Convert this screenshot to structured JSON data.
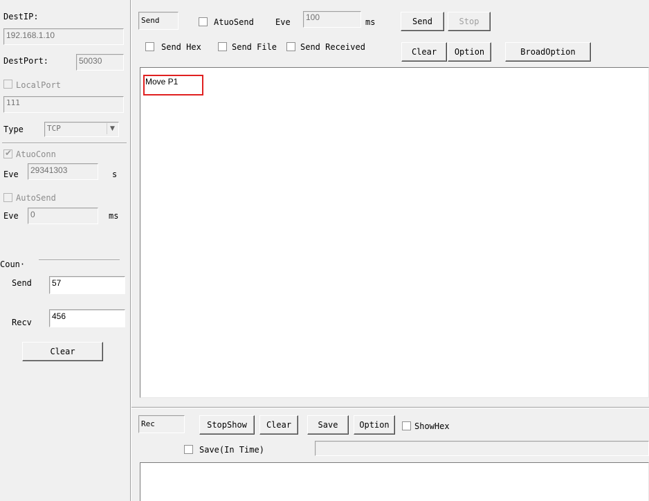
{
  "left_panel": {
    "dest_ip_label": "DestIP:",
    "dest_ip_value": "192.168.1.10",
    "dest_port_label": "DestPort:",
    "dest_port_value": "50030",
    "local_port_label": "LocalPort",
    "local_port_value": "111",
    "type_label": "Type",
    "type_value": "TCP",
    "auto_conn_label": "AtuoConn",
    "eve_label_1": "Eve",
    "eve_value_1": "29341303",
    "eve_unit_1": "s",
    "auto_send_label": "AutoSend",
    "eve_label_2": "Eve",
    "eve_value_2": "0",
    "eve_unit_2": "ms",
    "count_label": "Coun·",
    "send_label": "Send",
    "send_count": "57",
    "recv_label": "Recv",
    "recv_count": "456",
    "clear_button": "Clear"
  },
  "send_panel": {
    "mode_label": "Send",
    "auto_send_label": "AtuoSend",
    "eve_label": "Eve",
    "eve_value": "100",
    "ms_label": "ms",
    "send_button": "Send",
    "stop_button": "Stop",
    "send_hex_label": "Send Hex",
    "send_file_label": "Send File",
    "send_received_label": "Send Received",
    "clear_button": "Clear",
    "option_button": "Option",
    "broad_option_button": "BroadOption",
    "send_text": "Move P1"
  },
  "recv_panel": {
    "mode_label": "Rec",
    "stop_show_button": "StopShow",
    "clear_button": "Clear",
    "save_button": "Save",
    "option_button": "Option",
    "show_hex_label": "ShowHex",
    "save_in_time_label": "Save(In Time)"
  },
  "colors": {
    "window_bg": "#f0f0f0",
    "highlight_box": "#e02020"
  }
}
